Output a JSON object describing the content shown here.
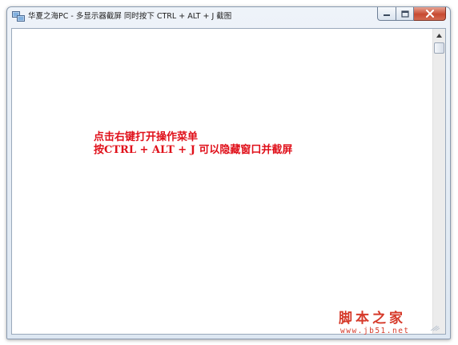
{
  "window": {
    "title": "华夏之海PC - 多显示器截屏  同时按下 CTRL + ALT + J 截图",
    "app_icon": "monitors-icon",
    "buttons": {
      "minimize": "minimize-icon",
      "maximize": "maximize-icon",
      "close": "close-icon"
    }
  },
  "content": {
    "line1": "点击右键打开操作菜单",
    "line2": "按CTRL + ALT + J 可以隐藏窗口并截屏"
  },
  "watermark": {
    "main": "脚本之家",
    "url": "www.jb51.net"
  },
  "colors": {
    "instruction_text": "#e0101a",
    "watermark": "#d63a2a",
    "close_button": "#c74a31"
  }
}
